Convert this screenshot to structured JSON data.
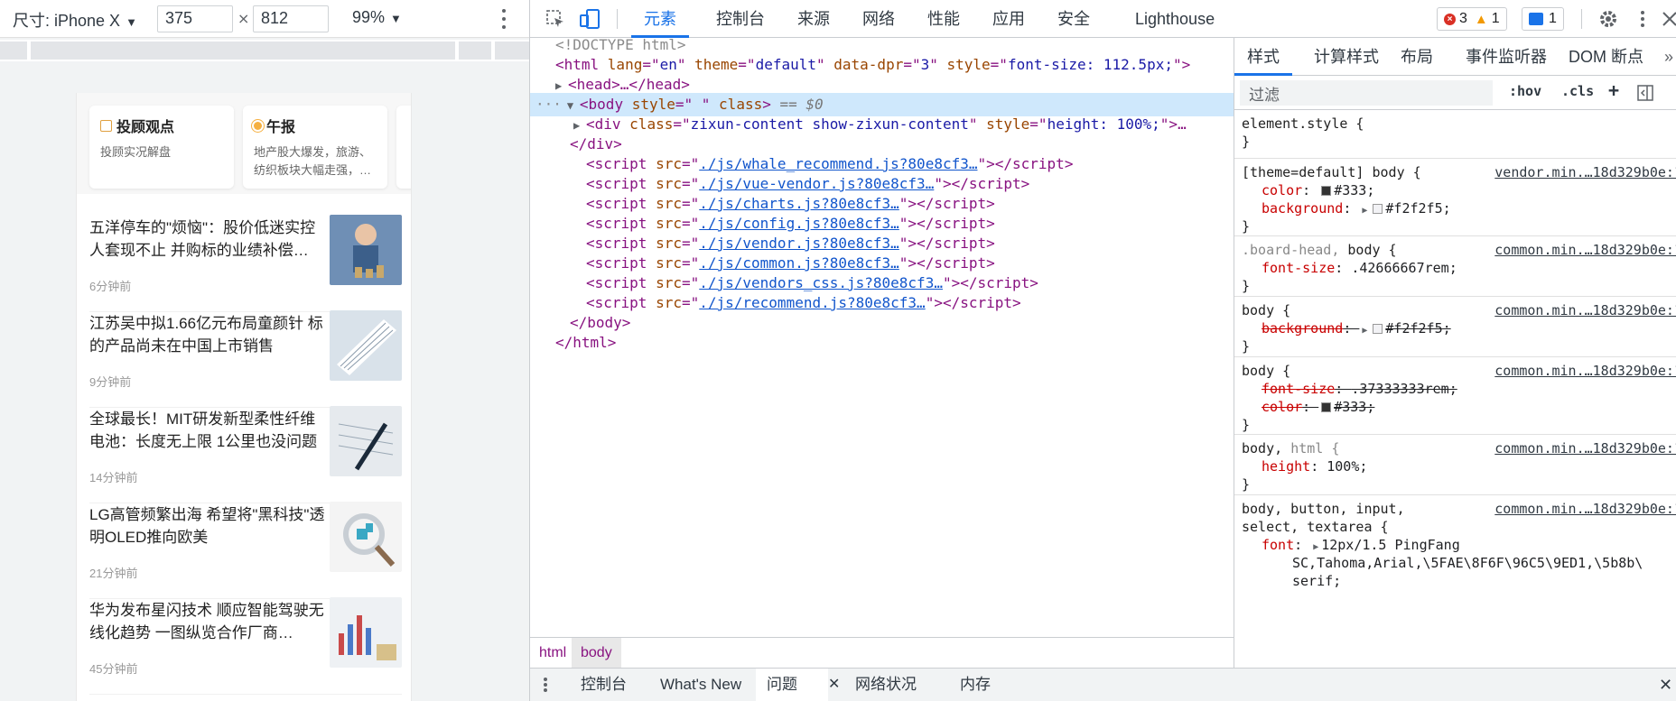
{
  "device_toolbar": {
    "device_label": "尺寸: iPhone X",
    "width": "375",
    "height": "812",
    "zoom": "99%"
  },
  "phone": {
    "cards": [
      {
        "title": "投顾观点",
        "subtitle": "投顾实况解盘"
      },
      {
        "title": "午报",
        "subtitle": "地产股大爆发，旅游、纺织板块大幅走强，…"
      }
    ],
    "news": [
      {
        "title": "五洋停车的\"烦恼\"：股价低迷实控人套现不止 并购标的业绩补偿…",
        "time": "6分钟前"
      },
      {
        "title": "江苏吴中拟1.66亿元布局童颜针 标的产品尚未在中国上市销售",
        "time": "9分钟前"
      },
      {
        "title": "全球最长！MIT研发新型柔性纤维电池：长度无上限 1公里也没问题",
        "time": "14分钟前"
      },
      {
        "title": "LG高管频繁出海 希望将\"黑科技\"透明OLED推向欧美",
        "time": "21分钟前"
      },
      {
        "title": "华为发布星闪技术 顺应智能驾驶无线化趋势 一图纵览合作厂商…",
        "time": "45分钟前"
      }
    ]
  },
  "devtools": {
    "tabs": [
      "元素",
      "控制台",
      "来源",
      "网络",
      "性能",
      "应用",
      "安全",
      "Lighthouse"
    ],
    "errors": "3",
    "warnings": "1",
    "messages": "1"
  },
  "elements": {
    "doctype": "<!DOCTYPE html>",
    "html_open": {
      "tag": "html",
      "attrs": [
        [
          "lang",
          "en"
        ],
        [
          "theme",
          "default"
        ],
        [
          "data-dpr",
          "3"
        ],
        [
          "style",
          "font-size: 112.5px;"
        ]
      ]
    },
    "head_collapsed": "<head>…</head>",
    "body_selected": {
      "style": " ",
      "marker": "== $0"
    },
    "div_line": {
      "class": "zixun-content show-zixun-content",
      "style": "height: 100%;"
    },
    "div_close": "</div>",
    "scripts": [
      "./js/whale_recommend.js?80e8cf3…",
      "./js/vue-vendor.js?80e8cf3…",
      "./js/charts.js?80e8cf3…",
      "./js/config.js?80e8cf3…",
      "./js/vendor.js?80e8cf3…",
      "./js/common.js?80e8cf3…",
      "./js/vendors_css.js?80e8cf3…",
      "./js/recommend.js?80e8cf3…"
    ],
    "body_close": "</body>",
    "html_close": "</html>"
  },
  "breadcrumbs": [
    "html",
    "body"
  ],
  "styles": {
    "tabs": [
      "样式",
      "计算样式",
      "布局",
      "事件监听器",
      "DOM 断点"
    ],
    "filter_placeholder": "过滤",
    "hov": ":hov",
    "cls": ".cls",
    "rules": [
      {
        "selector": "element.style {",
        "source": "",
        "props": []
      },
      {
        "selector": "[theme=default] body {",
        "source": "vendor.min.…18d329b0e:1",
        "props": [
          {
            "name": "color",
            "value": "#333",
            "swatch": "#333333",
            "struck": false,
            "expand": false
          },
          {
            "name": "background",
            "value": "#f2f2f5",
            "swatch": "#f2f2f5",
            "struck": false,
            "expand": true
          }
        ]
      },
      {
        "selector": ".board-head, body {",
        "source": "common.min.…18d329b0e:1",
        "props": [
          {
            "name": "font-size",
            "value": ".42666667rem",
            "swatch": "",
            "struck": false,
            "expand": false
          }
        ]
      },
      {
        "selector": "body {",
        "source": "common.min.…18d329b0e:1",
        "props": [
          {
            "name": "background",
            "value": "#f2f2f5",
            "swatch": "#f2f2f5",
            "struck": true,
            "expand": true
          }
        ]
      },
      {
        "selector": "body {",
        "source": "common.min.…18d329b0e:1",
        "props": [
          {
            "name": "font-size",
            "value": ".37333333rem",
            "swatch": "",
            "struck": true,
            "expand": false
          },
          {
            "name": "color",
            "value": "#333",
            "swatch": "#333333",
            "struck": true,
            "expand": false
          }
        ]
      },
      {
        "selector": "body, html {",
        "source": "common.min.…18d329b0e:1",
        "props": [
          {
            "name": "height",
            "value": "100%",
            "swatch": "",
            "struck": false,
            "expand": false
          }
        ]
      }
    ],
    "last_rule": {
      "selector_line1": "body, button, input,",
      "selector_line2": "select, textarea {",
      "source": "common.min.…18d329b0e:1",
      "font_name": "font",
      "font_value1": "12px/1.5 PingFang",
      "font_value2": "SC,Tahoma,Arial,\\5FAE\\8F6F\\96C5\\9ED1,\\5b8b\\",
      "font_value3": "serif;"
    }
  },
  "drawer": {
    "tabs": [
      "控制台",
      "What's New",
      "问题",
      "网络状况",
      "内存"
    ]
  },
  "colors": {
    "accent": "#1a73e8",
    "selected_row": "#cfe8fc",
    "tag": "#881280",
    "attr_name": "#994500",
    "attr_value": "#1a1aa6"
  }
}
